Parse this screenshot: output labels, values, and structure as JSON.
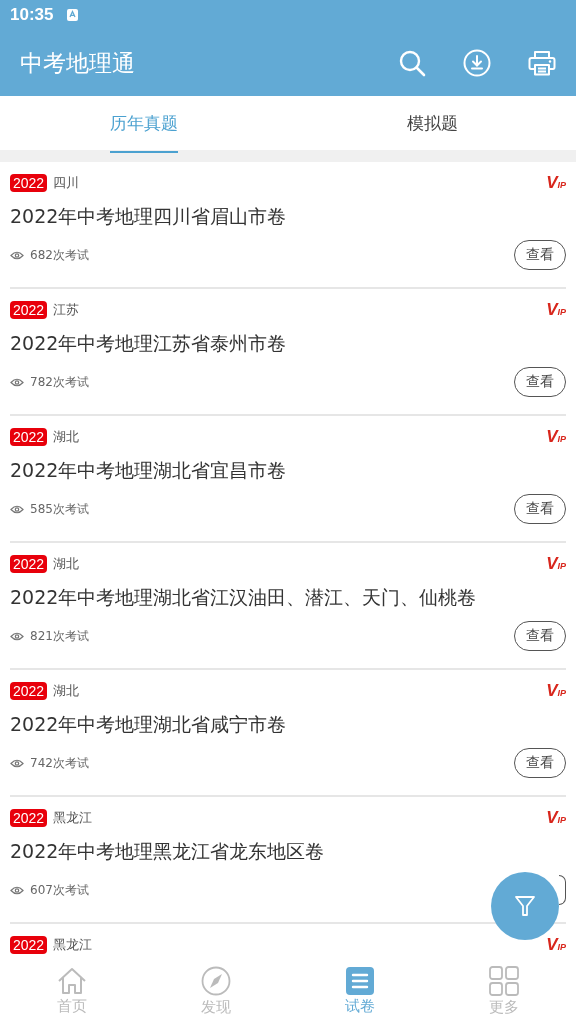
{
  "status_bar": {
    "time": "10:35"
  },
  "app_bar": {
    "title": "中考地理通"
  },
  "tabs": [
    {
      "label": "历年真题",
      "selected": true
    },
    {
      "label": "模拟题",
      "selected": false
    }
  ],
  "papers": [
    {
      "year": "2022",
      "region": "四川",
      "vip": "VIP",
      "title": "2022年中考地理四川省眉山市卷",
      "views": "682次考试",
      "button": "查看"
    },
    {
      "year": "2022",
      "region": "江苏",
      "vip": "VIP",
      "title": "2022年中考地理江苏省泰州市卷",
      "views": "782次考试",
      "button": "查看"
    },
    {
      "year": "2022",
      "region": "湖北",
      "vip": "VIP",
      "title": "2022年中考地理湖北省宜昌市卷",
      "views": "585次考试",
      "button": "查看"
    },
    {
      "year": "2022",
      "region": "湖北",
      "vip": "VIP",
      "title": "2022年中考地理湖北省江汉油田、潜江、天门、仙桃卷",
      "views": "821次考试",
      "button": "查看"
    },
    {
      "year": "2022",
      "region": "湖北",
      "vip": "VIP",
      "title": "2022年中考地理湖北省咸宁市卷",
      "views": "742次考试",
      "button": "查看"
    },
    {
      "year": "2022",
      "region": "黑龙江",
      "vip": "VIP",
      "title": "2022年中考地理黑龙江省龙东地区卷",
      "views": "607次考试"
    },
    {
      "year": "2022",
      "region": "黑龙江",
      "vip": "VIP"
    }
  ],
  "bottom_nav": [
    {
      "label": "首页",
      "kind": "home",
      "selected": false
    },
    {
      "label": "发现",
      "kind": "discover",
      "selected": false
    },
    {
      "label": "试卷",
      "kind": "papers",
      "selected": true
    },
    {
      "label": "更多",
      "kind": "more",
      "selected": false
    }
  ]
}
